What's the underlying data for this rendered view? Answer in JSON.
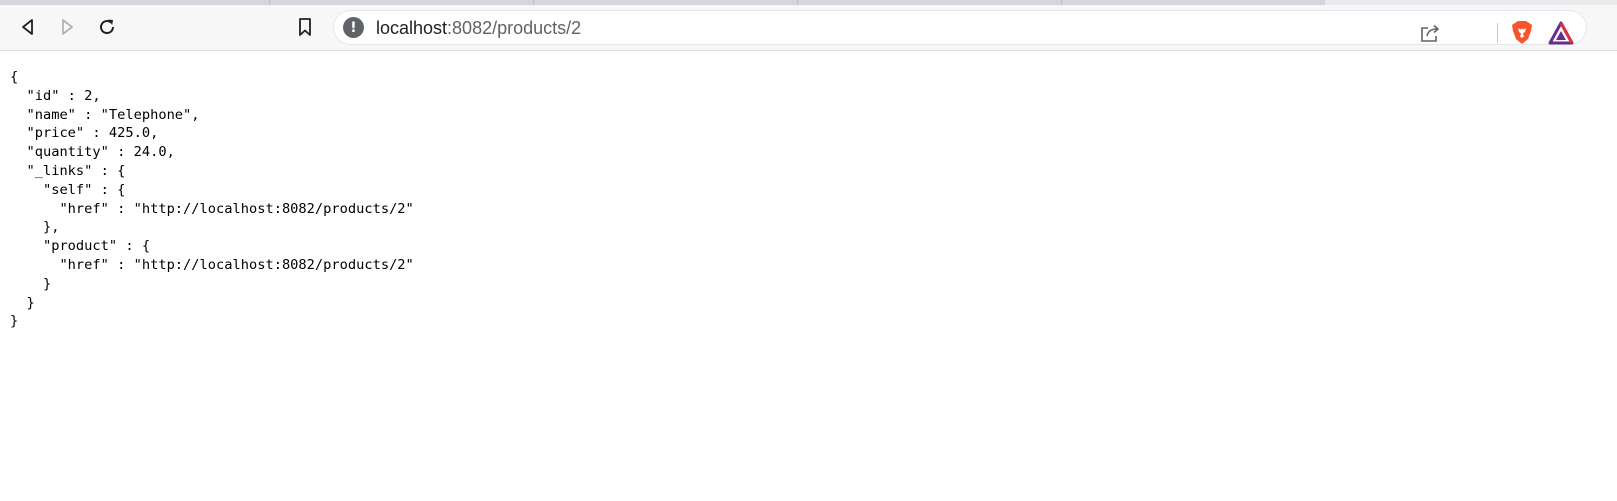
{
  "browser": {
    "url_host": "localhost",
    "url_path": ":8082/products/2",
    "icons": {
      "back": "back-arrow-icon",
      "forward": "forward-arrow-icon",
      "reload": "reload-icon",
      "bookmark": "bookmark-icon",
      "site_info": "info-icon",
      "share": "share-icon",
      "brave_shields": "brave-lion-icon",
      "rewards": "brave-rewards-triangle-icon"
    },
    "site_info_glyph": "!",
    "colors": {
      "brave_orange": "#fb542b",
      "rewards_purple": "#662d91",
      "rewards_red": "#e02f3b"
    }
  },
  "response": {
    "text": "{\n  \"id\" : 2,\n  \"name\" : \"Telephone\",\n  \"price\" : 425.0,\n  \"quantity\" : 24.0,\n  \"_links\" : {\n    \"self\" : {\n      \"href\" : \"http://localhost:8082/products/2\"\n    },\n    \"product\" : {\n      \"href\" : \"http://localhost:8082/products/2\"\n    }\n  }\n}"
  }
}
